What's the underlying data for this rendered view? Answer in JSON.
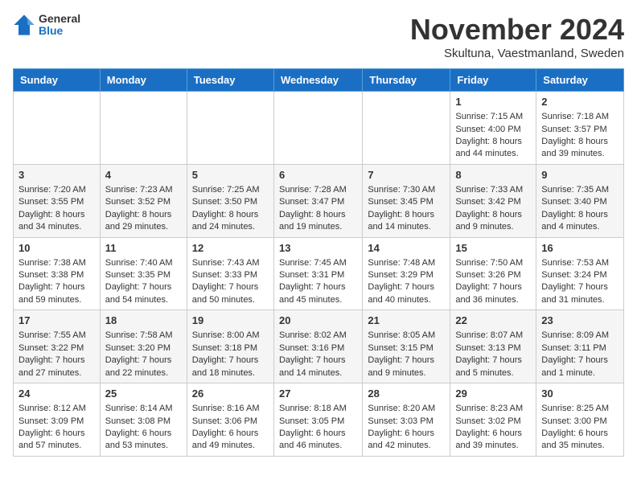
{
  "header": {
    "logo_general": "General",
    "logo_blue": "Blue",
    "month_title": "November 2024",
    "subtitle": "Skultuna, Vaestmanland, Sweden"
  },
  "weekdays": [
    "Sunday",
    "Monday",
    "Tuesday",
    "Wednesday",
    "Thursday",
    "Friday",
    "Saturday"
  ],
  "weeks": [
    [
      {
        "day": "",
        "sunrise": "",
        "sunset": "",
        "daylight": ""
      },
      {
        "day": "",
        "sunrise": "",
        "sunset": "",
        "daylight": ""
      },
      {
        "day": "",
        "sunrise": "",
        "sunset": "",
        "daylight": ""
      },
      {
        "day": "",
        "sunrise": "",
        "sunset": "",
        "daylight": ""
      },
      {
        "day": "",
        "sunrise": "",
        "sunset": "",
        "daylight": ""
      },
      {
        "day": "1",
        "sunrise": "Sunrise: 7:15 AM",
        "sunset": "Sunset: 4:00 PM",
        "daylight": "Daylight: 8 hours and 44 minutes."
      },
      {
        "day": "2",
        "sunrise": "Sunrise: 7:18 AM",
        "sunset": "Sunset: 3:57 PM",
        "daylight": "Daylight: 8 hours and 39 minutes."
      }
    ],
    [
      {
        "day": "3",
        "sunrise": "Sunrise: 7:20 AM",
        "sunset": "Sunset: 3:55 PM",
        "daylight": "Daylight: 8 hours and 34 minutes."
      },
      {
        "day": "4",
        "sunrise": "Sunrise: 7:23 AM",
        "sunset": "Sunset: 3:52 PM",
        "daylight": "Daylight: 8 hours and 29 minutes."
      },
      {
        "day": "5",
        "sunrise": "Sunrise: 7:25 AM",
        "sunset": "Sunset: 3:50 PM",
        "daylight": "Daylight: 8 hours and 24 minutes."
      },
      {
        "day": "6",
        "sunrise": "Sunrise: 7:28 AM",
        "sunset": "Sunset: 3:47 PM",
        "daylight": "Daylight: 8 hours and 19 minutes."
      },
      {
        "day": "7",
        "sunrise": "Sunrise: 7:30 AM",
        "sunset": "Sunset: 3:45 PM",
        "daylight": "Daylight: 8 hours and 14 minutes."
      },
      {
        "day": "8",
        "sunrise": "Sunrise: 7:33 AM",
        "sunset": "Sunset: 3:42 PM",
        "daylight": "Daylight: 8 hours and 9 minutes."
      },
      {
        "day": "9",
        "sunrise": "Sunrise: 7:35 AM",
        "sunset": "Sunset: 3:40 PM",
        "daylight": "Daylight: 8 hours and 4 minutes."
      }
    ],
    [
      {
        "day": "10",
        "sunrise": "Sunrise: 7:38 AM",
        "sunset": "Sunset: 3:38 PM",
        "daylight": "Daylight: 7 hours and 59 minutes."
      },
      {
        "day": "11",
        "sunrise": "Sunrise: 7:40 AM",
        "sunset": "Sunset: 3:35 PM",
        "daylight": "Daylight: 7 hours and 54 minutes."
      },
      {
        "day": "12",
        "sunrise": "Sunrise: 7:43 AM",
        "sunset": "Sunset: 3:33 PM",
        "daylight": "Daylight: 7 hours and 50 minutes."
      },
      {
        "day": "13",
        "sunrise": "Sunrise: 7:45 AM",
        "sunset": "Sunset: 3:31 PM",
        "daylight": "Daylight: 7 hours and 45 minutes."
      },
      {
        "day": "14",
        "sunrise": "Sunrise: 7:48 AM",
        "sunset": "Sunset: 3:29 PM",
        "daylight": "Daylight: 7 hours and 40 minutes."
      },
      {
        "day": "15",
        "sunrise": "Sunrise: 7:50 AM",
        "sunset": "Sunset: 3:26 PM",
        "daylight": "Daylight: 7 hours and 36 minutes."
      },
      {
        "day": "16",
        "sunrise": "Sunrise: 7:53 AM",
        "sunset": "Sunset: 3:24 PM",
        "daylight": "Daylight: 7 hours and 31 minutes."
      }
    ],
    [
      {
        "day": "17",
        "sunrise": "Sunrise: 7:55 AM",
        "sunset": "Sunset: 3:22 PM",
        "daylight": "Daylight: 7 hours and 27 minutes."
      },
      {
        "day": "18",
        "sunrise": "Sunrise: 7:58 AM",
        "sunset": "Sunset: 3:20 PM",
        "daylight": "Daylight: 7 hours and 22 minutes."
      },
      {
        "day": "19",
        "sunrise": "Sunrise: 8:00 AM",
        "sunset": "Sunset: 3:18 PM",
        "daylight": "Daylight: 7 hours and 18 minutes."
      },
      {
        "day": "20",
        "sunrise": "Sunrise: 8:02 AM",
        "sunset": "Sunset: 3:16 PM",
        "daylight": "Daylight: 7 hours and 14 minutes."
      },
      {
        "day": "21",
        "sunrise": "Sunrise: 8:05 AM",
        "sunset": "Sunset: 3:15 PM",
        "daylight": "Daylight: 7 hours and 9 minutes."
      },
      {
        "day": "22",
        "sunrise": "Sunrise: 8:07 AM",
        "sunset": "Sunset: 3:13 PM",
        "daylight": "Daylight: 7 hours and 5 minutes."
      },
      {
        "day": "23",
        "sunrise": "Sunrise: 8:09 AM",
        "sunset": "Sunset: 3:11 PM",
        "daylight": "Daylight: 7 hours and 1 minute."
      }
    ],
    [
      {
        "day": "24",
        "sunrise": "Sunrise: 8:12 AM",
        "sunset": "Sunset: 3:09 PM",
        "daylight": "Daylight: 6 hours and 57 minutes."
      },
      {
        "day": "25",
        "sunrise": "Sunrise: 8:14 AM",
        "sunset": "Sunset: 3:08 PM",
        "daylight": "Daylight: 6 hours and 53 minutes."
      },
      {
        "day": "26",
        "sunrise": "Sunrise: 8:16 AM",
        "sunset": "Sunset: 3:06 PM",
        "daylight": "Daylight: 6 hours and 49 minutes."
      },
      {
        "day": "27",
        "sunrise": "Sunrise: 8:18 AM",
        "sunset": "Sunset: 3:05 PM",
        "daylight": "Daylight: 6 hours and 46 minutes."
      },
      {
        "day": "28",
        "sunrise": "Sunrise: 8:20 AM",
        "sunset": "Sunset: 3:03 PM",
        "daylight": "Daylight: 6 hours and 42 minutes."
      },
      {
        "day": "29",
        "sunrise": "Sunrise: 8:23 AM",
        "sunset": "Sunset: 3:02 PM",
        "daylight": "Daylight: 6 hours and 39 minutes."
      },
      {
        "day": "30",
        "sunrise": "Sunrise: 8:25 AM",
        "sunset": "Sunset: 3:00 PM",
        "daylight": "Daylight: 6 hours and 35 minutes."
      }
    ]
  ]
}
